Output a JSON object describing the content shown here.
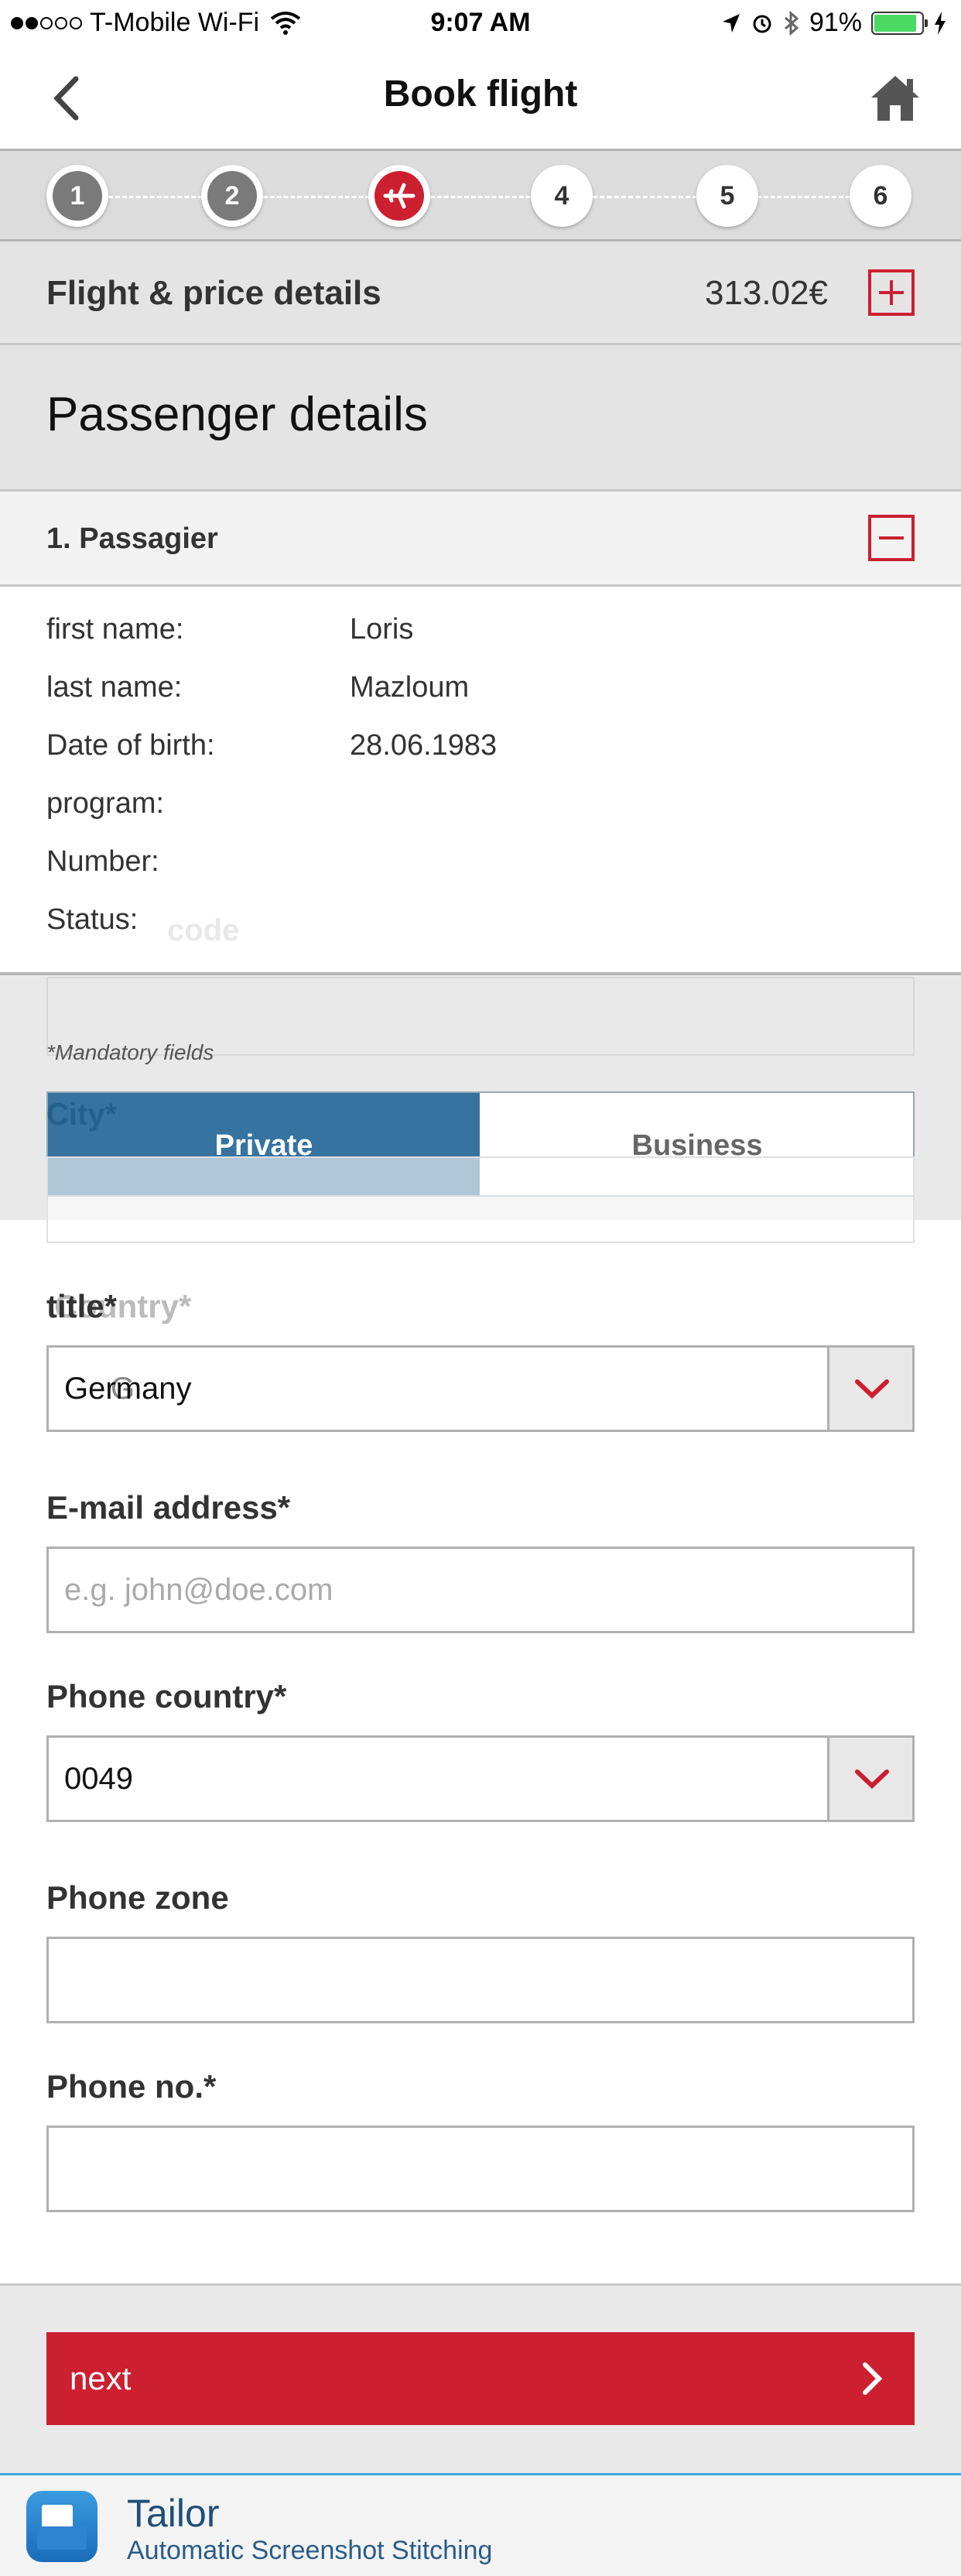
{
  "status_bar": {
    "carrier": "T-Mobile Wi-Fi",
    "time": "9:07 AM",
    "battery": "91%"
  },
  "nav": {
    "title": "Book flight"
  },
  "stepper": {
    "steps": [
      "1",
      "2",
      "",
      "4",
      "5",
      "6"
    ]
  },
  "price_bar": {
    "label": "Flight & price details",
    "amount": "313.02€"
  },
  "section": {
    "title": "Passenger details"
  },
  "passenger": {
    "header": "1. Passagier",
    "fields": [
      {
        "key": "first name:",
        "value": "Loris"
      },
      {
        "key": "last name:",
        "value": "Mazloum"
      },
      {
        "key": "Date of birth:",
        "value": "28.06.1983"
      },
      {
        "key": "program:",
        "value": ""
      },
      {
        "key": "Number:",
        "value": ""
      },
      {
        "key": "Status:",
        "value": ""
      }
    ],
    "faded_text": "code"
  },
  "form": {
    "mandatory_note": "*Mandatory fields",
    "toggle": {
      "private": "Private",
      "business": "Business"
    },
    "city_ghost": "City*",
    "title_label": "title*",
    "country_ghost": "Country*",
    "country_value": "Germany",
    "ghost_char": "G",
    "email_label": "E-mail address*",
    "email_placeholder": "e.g. john@doe.com",
    "phone_country_label": "Phone country*",
    "phone_country_value": "0049",
    "phone_zone_label": "Phone zone",
    "phone_no_label": "Phone no.*"
  },
  "actions": {
    "next": "next"
  },
  "footer": {
    "app_name": "Tailor",
    "tagline": "Automatic Screenshot Stitching"
  },
  "colors": {
    "accent": "#cc1f30",
    "toggle_active": "#2b6da0"
  }
}
